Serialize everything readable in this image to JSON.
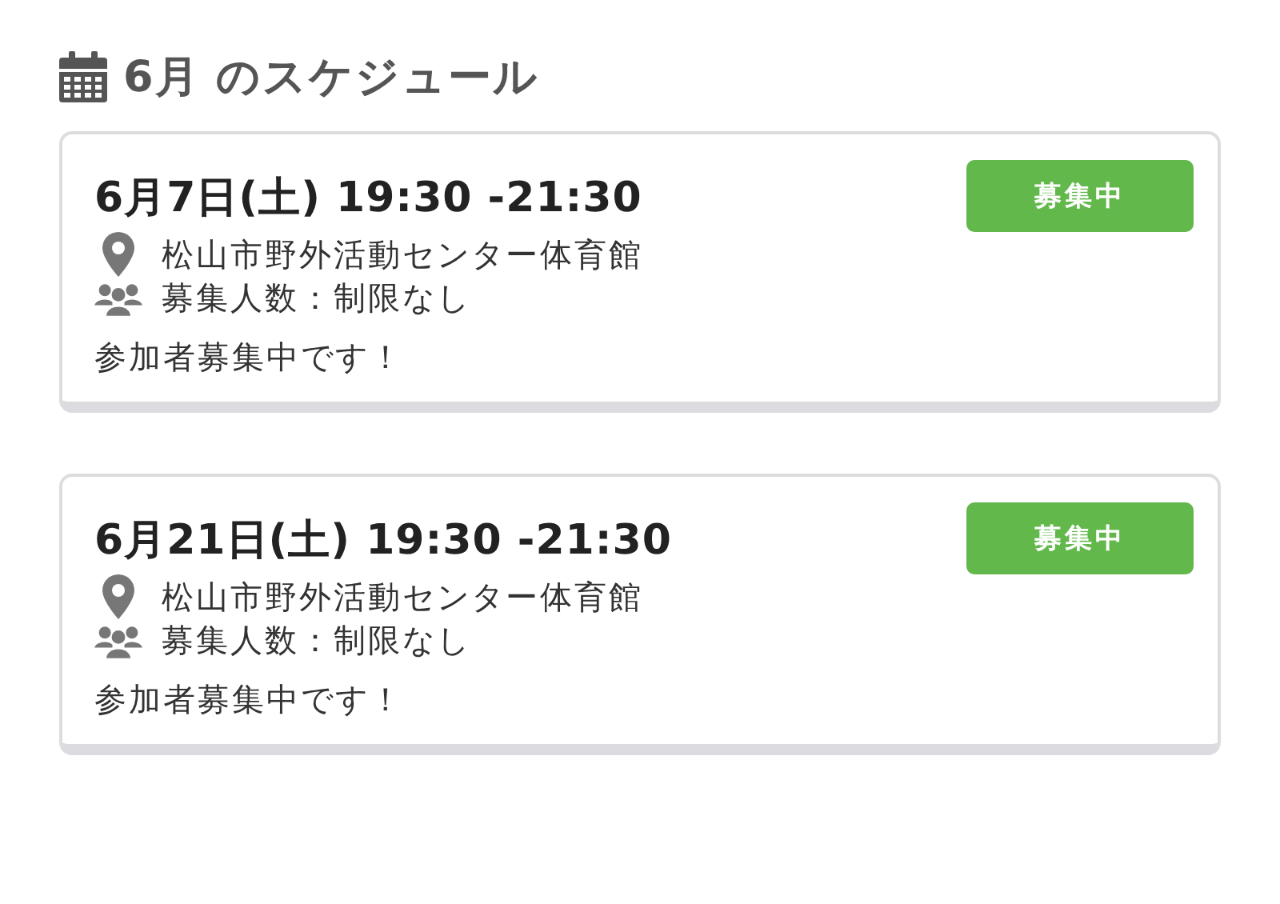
{
  "heading": {
    "title": "6月 のスケジュール"
  },
  "events": [
    {
      "datetime": "6月7日(土) 19:30 -21:30",
      "status": "募集中",
      "venue": "松山市野外活動センター体育館",
      "capacity": "募集人数：制限なし",
      "note": "参加者募集中です！"
    },
    {
      "datetime": "6月21日(土) 19:30 -21:30",
      "status": "募集中",
      "venue": "松山市野外活動センター体育館",
      "capacity": "募集人数：制限なし",
      "note": "参加者募集中です！"
    }
  ]
}
